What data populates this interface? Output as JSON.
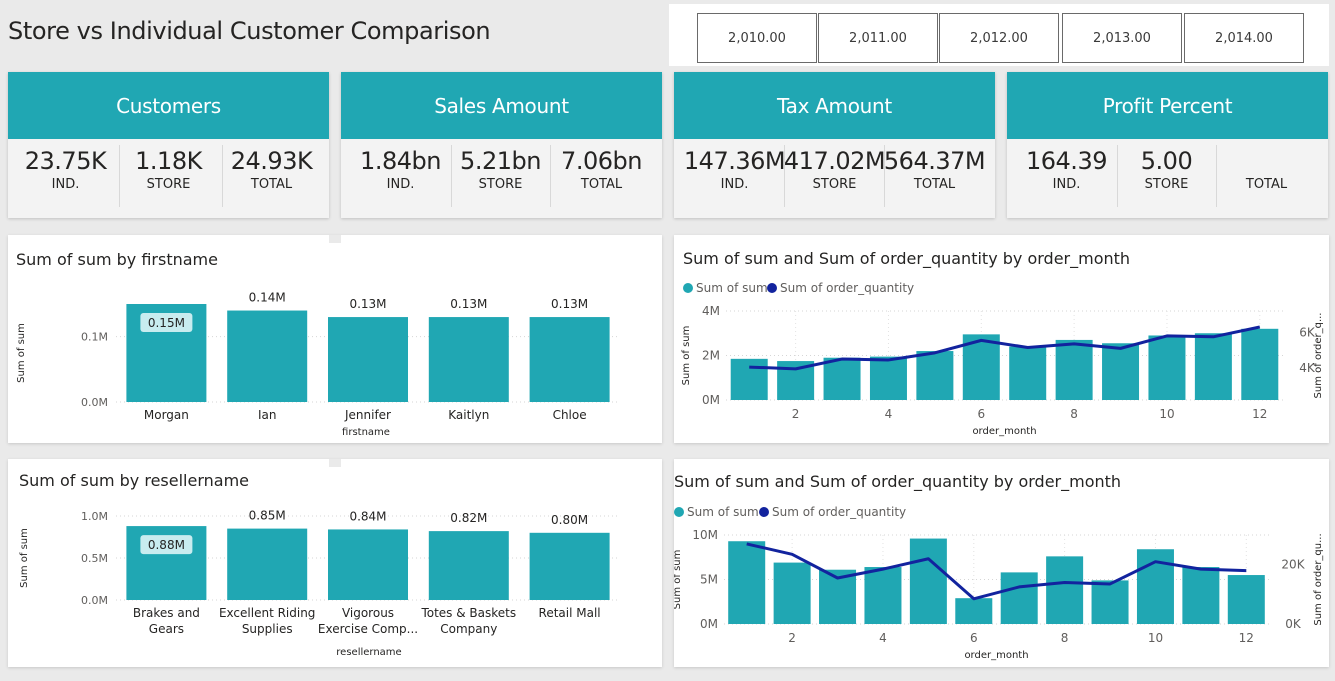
{
  "header": {
    "title": "Store vs Individual Customer Comparison"
  },
  "year_slicer": [
    "2,010.00",
    "2,011.00",
    "2,012.00",
    "2,013.00",
    "2,014.00"
  ],
  "cards": [
    {
      "title": "Customers",
      "kpis": [
        {
          "value": "23.75K",
          "label": "IND."
        },
        {
          "value": "1.18K",
          "label": "STORE"
        },
        {
          "value": "24.93K",
          "label": "TOTAL"
        }
      ]
    },
    {
      "title": "Sales Amount",
      "kpis": [
        {
          "value": "1.84bn",
          "label": "IND."
        },
        {
          "value": "5.21bn",
          "label": "STORE"
        },
        {
          "value": "7.06bn",
          "label": "TOTAL"
        }
      ]
    },
    {
      "title": "Tax Amount",
      "kpis": [
        {
          "value": "147.36M",
          "label": "IND."
        },
        {
          "value": "417.02M",
          "label": "STORE"
        },
        {
          "value": "564.37M",
          "label": "TOTAL"
        }
      ]
    },
    {
      "title": "Profit Percent",
      "kpis": [
        {
          "value": "164.39",
          "label": "IND."
        },
        {
          "value": "5.00",
          "label": "STORE"
        },
        {
          "value": "",
          "label": "TOTAL"
        }
      ]
    }
  ],
  "colors": {
    "teal": "#20a7b3",
    "navy": "#12239e",
    "bg": "#eaeaea"
  },
  "chart_data": [
    {
      "type": "bar",
      "title": "Sum of sum by firstname",
      "xlabel": "firstname",
      "ylabel": "Sum of sum",
      "categories": [
        "Morgan",
        "Ian",
        "Jennifer",
        "Kaitlyn",
        "Chloe"
      ],
      "values": [
        0.15,
        0.14,
        0.13,
        0.13,
        0.13
      ],
      "data_labels": [
        "0.15M",
        "0.14M",
        "0.13M",
        "0.13M",
        "0.13M"
      ],
      "y_ticks": [
        {
          "v": 0,
          "label": "0.0M"
        },
        {
          "v": 0.1,
          "label": "0.1M"
        }
      ],
      "ylim": [
        0,
        0.15
      ]
    },
    {
      "type": "bar",
      "title": "Sum of sum by resellername",
      "xlabel": "resellername",
      "ylabel": "Sum of sum",
      "categories": [
        [
          "Brakes and",
          "Gears"
        ],
        [
          "Excellent Riding",
          "Supplies"
        ],
        [
          "Vigorous",
          "Exercise Comp..."
        ],
        [
          "Totes & Baskets",
          "Company"
        ],
        [
          "Retail Mall"
        ]
      ],
      "values": [
        0.88,
        0.85,
        0.84,
        0.82,
        0.8
      ],
      "data_labels": [
        "0.88M",
        "0.85M",
        "0.84M",
        "0.82M",
        "0.80M"
      ],
      "y_ticks": [
        {
          "v": 0,
          "label": "0.0M"
        },
        {
          "v": 0.5,
          "label": "0.5M"
        },
        {
          "v": 1.0,
          "label": "1.0M"
        }
      ],
      "ylim": [
        0,
        1.0
      ]
    },
    {
      "type": "bar+line",
      "title": "Sum of sum and Sum of order_quantity by order_month",
      "xlabel": "order_month",
      "ylabel": "Sum of sum",
      "ylabel2": "Sum of order_q...",
      "legend": [
        "Sum of sum",
        "Sum of order_quantity"
      ],
      "x": [
        1,
        2,
        3,
        4,
        5,
        6,
        7,
        8,
        9,
        10,
        11,
        12
      ],
      "x_ticks": [
        2,
        4,
        6,
        8,
        10,
        12
      ],
      "bars": [
        1.85,
        1.75,
        1.9,
        1.95,
        2.2,
        2.95,
        2.4,
        2.7,
        2.55,
        2.9,
        3.0,
        3.2
      ],
      "line": [
        4050,
        3950,
        4500,
        4450,
        4850,
        5550,
        5150,
        5350,
        5100,
        5800,
        5750,
        6300
      ],
      "y_ticks": [
        {
          "v": 0,
          "label": "0M"
        },
        {
          "v": 2,
          "label": "2M"
        },
        {
          "v": 4,
          "label": "4M"
        }
      ],
      "y2_ticks": [
        {
          "v": 4000,
          "label": "4K"
        },
        {
          "v": 6000,
          "label": "6K"
        }
      ],
      "ylim": [
        0,
        4
      ],
      "y2lim": [
        2200,
        7200
      ]
    },
    {
      "type": "bar+line",
      "title": "Sum of sum and Sum of order_quantity by order_month",
      "xlabel": "order_month",
      "ylabel": "Sum of sum",
      "ylabel2": "Sum of order_qu...",
      "legend": [
        "Sum of sum",
        "Sum of order_quantity"
      ],
      "x": [
        1,
        2,
        3,
        4,
        5,
        6,
        7,
        8,
        9,
        10,
        11,
        12
      ],
      "x_ticks": [
        2,
        4,
        6,
        8,
        10,
        12
      ],
      "bars": [
        9.3,
        6.9,
        6.1,
        6.4,
        9.6,
        2.9,
        5.8,
        7.6,
        4.9,
        8.4,
        6.4,
        5.5
      ],
      "line": [
        27000,
        23500,
        15500,
        18500,
        22000,
        8500,
        12500,
        14000,
        13500,
        21000,
        18500,
        18000
      ],
      "y_ticks": [
        {
          "v": 0,
          "label": "0M"
        },
        {
          "v": 5,
          "label": "5M"
        },
        {
          "v": 10,
          "label": "10M"
        }
      ],
      "y2_ticks": [
        {
          "v": 0,
          "label": "0K"
        },
        {
          "v": 20000,
          "label": "20K"
        }
      ],
      "ylim": [
        0,
        10
      ],
      "y2lim": [
        0,
        30000
      ]
    }
  ]
}
